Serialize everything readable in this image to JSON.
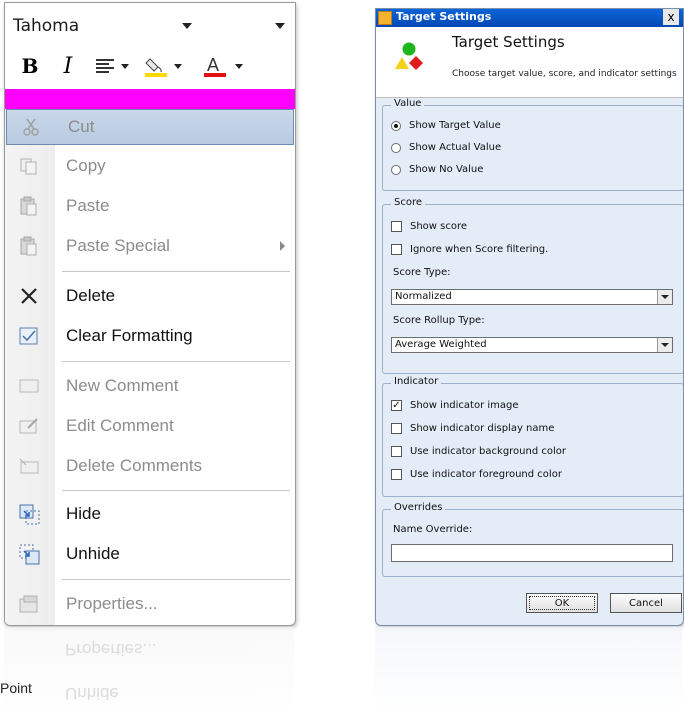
{
  "mini_toolbar": {
    "font_name": "Tahoma",
    "bold_label": "B",
    "italic_label": "I"
  },
  "context_menu": {
    "items": [
      {
        "label": "Cut",
        "enabled": false,
        "highlighted": true,
        "icon": "scissors-icon"
      },
      {
        "label": "Copy",
        "enabled": false,
        "icon": "copy-icon"
      },
      {
        "label": "Paste",
        "enabled": false,
        "icon": "paste-icon"
      },
      {
        "label": "Paste Special",
        "enabled": false,
        "icon": "paste-special-icon",
        "submenu": true
      },
      {
        "label": "Delete",
        "enabled": true,
        "icon": "delete-x-icon"
      },
      {
        "label": "Clear Formatting",
        "enabled": true,
        "icon": "clear-formatting-icon"
      },
      {
        "label": "New Comment",
        "enabled": false,
        "icon": "new-comment-icon"
      },
      {
        "label": "Edit Comment",
        "enabled": false,
        "icon": "edit-comment-icon"
      },
      {
        "label": "Delete Comments",
        "enabled": false,
        "icon": "delete-comments-icon"
      },
      {
        "label": "Hide",
        "enabled": true,
        "icon": "hide-icon"
      },
      {
        "label": "Unhide",
        "enabled": true,
        "icon": "unhide-icon"
      },
      {
        "label": "Properties...",
        "enabled": false,
        "icon": "properties-icon"
      }
    ],
    "reflection_labels": [
      "Properties...",
      "Unhide"
    ]
  },
  "side_text": "Point",
  "dialog": {
    "window_title": "Target Settings",
    "close_label": "x",
    "heading": "Target Settings",
    "subheading": "Choose target value, score, and indicator settings",
    "value_group": {
      "caption": "Value",
      "options": [
        "Show Target Value",
        "Show Actual Value",
        "Show No Value"
      ],
      "selected": "Show Target Value"
    },
    "score_group": {
      "caption": "Score",
      "show_score": "Show score",
      "ignore_filtering": "Ignore when Score filtering.",
      "score_type_label": "Score Type:",
      "score_type_value": "Normalized",
      "rollup_label": "Score Rollup Type:",
      "rollup_value": "Average Weighted"
    },
    "indicator_group": {
      "caption": "Indicator",
      "options": [
        "Show indicator image",
        "Show indicator display name",
        "Use indicator background color",
        "Use indicator foreground color"
      ],
      "checked": [
        "Show indicator image"
      ]
    },
    "overrides_group": {
      "caption": "Overrides",
      "name_override_label": "Name Override:",
      "name_override_value": ""
    },
    "ok_label": "OK",
    "cancel_label": "Cancel"
  },
  "colors": {
    "highlight_bar": "#ff00ff",
    "dialog_bg": "#e3ecf7",
    "title_bar": "#0a5bd0"
  }
}
